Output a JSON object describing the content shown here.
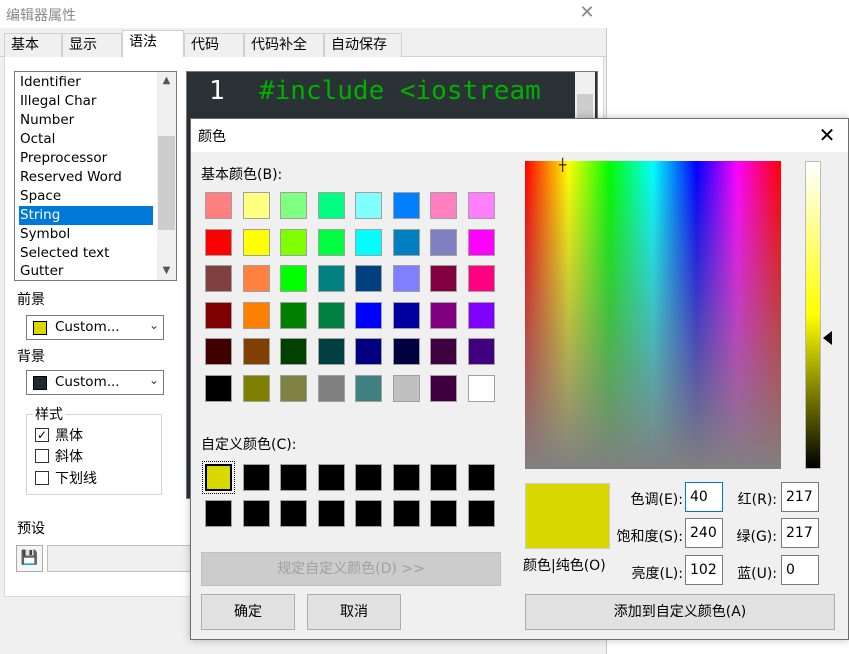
{
  "props_window": {
    "title": "编辑器属性",
    "close_label": "✕",
    "tabs": [
      "基本",
      "显示",
      "语法",
      "代码",
      "代码补全",
      "自动保存"
    ],
    "active_tab": "语法",
    "syntax_items": [
      "Identifier",
      "Illegal Char",
      "Number",
      "Octal",
      "Preprocessor",
      "Reserved Word",
      "Space",
      "String",
      "Symbol",
      "Selected text",
      "Gutter"
    ],
    "selected_item": "String",
    "foreground_label": "前景",
    "foreground_value": "Custom...",
    "foreground_color": "#d9d900",
    "background_label": "背景",
    "background_value": "Custom...",
    "background_color": "#1e2a2f",
    "style_label": "样式",
    "style_bold": "黑体",
    "style_italic": "斜体",
    "style_underline": "下划线",
    "bold_checked": true,
    "italic_checked": false,
    "underline_checked": false,
    "preset_label": "预设",
    "code_line_number": "1",
    "code_text": "#include <iostream"
  },
  "color_dialog": {
    "title": "颜色",
    "close_label": "✕",
    "basic_colors_label": "基本颜色(B):",
    "basic_colors": [
      "#ff8080",
      "#ffff80",
      "#80ff80",
      "#00ff80",
      "#80ffff",
      "#0080ff",
      "#ff80c0",
      "#ff80ff",
      "#ff0000",
      "#ffff00",
      "#80ff00",
      "#00ff40",
      "#00ffff",
      "#0080c0",
      "#8080c0",
      "#ff00ff",
      "#804040",
      "#ff8040",
      "#00ff00",
      "#008080",
      "#004080",
      "#8080ff",
      "#800040",
      "#ff0080",
      "#800000",
      "#ff8000",
      "#008000",
      "#008040",
      "#0000ff",
      "#0000a0",
      "#800080",
      "#8000ff",
      "#400000",
      "#804000",
      "#004000",
      "#004040",
      "#000080",
      "#000040",
      "#400040",
      "#400080",
      "#000000",
      "#808000",
      "#808040",
      "#808080",
      "#408080",
      "#c0c0c0",
      "#400040",
      "#ffffff"
    ],
    "custom_colors_label": "自定义颜色(C):",
    "custom_colors": [
      "#d9d900",
      "#000000",
      "#000000",
      "#000000",
      "#000000",
      "#000000",
      "#000000",
      "#000000",
      "#000000",
      "#000000",
      "#000000",
      "#000000",
      "#000000",
      "#000000",
      "#000000",
      "#000000"
    ],
    "define_custom_label": "规定自定义颜色(D) >>",
    "ok_label": "确定",
    "cancel_label": "取消",
    "preview_label": "颜色|纯色(O)",
    "preview_color": "#d9d900",
    "hue_label": "色调(E):",
    "hue_value": "40",
    "sat_label": "饱和度(S):",
    "sat_value": "240",
    "lum_label": "亮度(L):",
    "lum_value": "102",
    "red_label": "红(R):",
    "red_value": "217",
    "green_label": "绿(G):",
    "green_value": "217",
    "blue_label": "蓝(U):",
    "blue_value": "0",
    "add_custom_label": "添加到自定义颜色(A)"
  }
}
